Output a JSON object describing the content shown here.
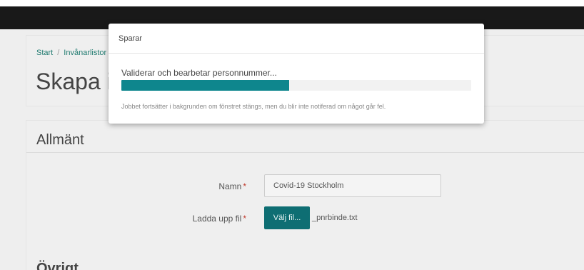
{
  "page": {
    "breadcrumb": {
      "start": "Start",
      "separator": "/",
      "current": "Invånarlistor"
    },
    "title": "Skapa invånarlista",
    "section_title": "Allmänt",
    "next_section_title": "Övrigt"
  },
  "form": {
    "name_label": "Namn",
    "name_value": "Covid-19 Stockholm",
    "upload_label": "Ladda upp fil",
    "required_mark": "*",
    "file_button": "Välj fil...",
    "file_name": "_pnrbinde.txt"
  },
  "modal": {
    "title": "Sparar",
    "progress_label": "Validerar och bearbetar personnummer...",
    "progress_fraction": 0.48,
    "note": "Jobbet fortsätter i bakgrunden om fönstret stängs, men du blir inte notiferad om något går fel."
  },
  "colors": {
    "topbar": "#191919",
    "accent": "#0e868d",
    "button": "#0e6e73",
    "required": "#c0392b"
  }
}
